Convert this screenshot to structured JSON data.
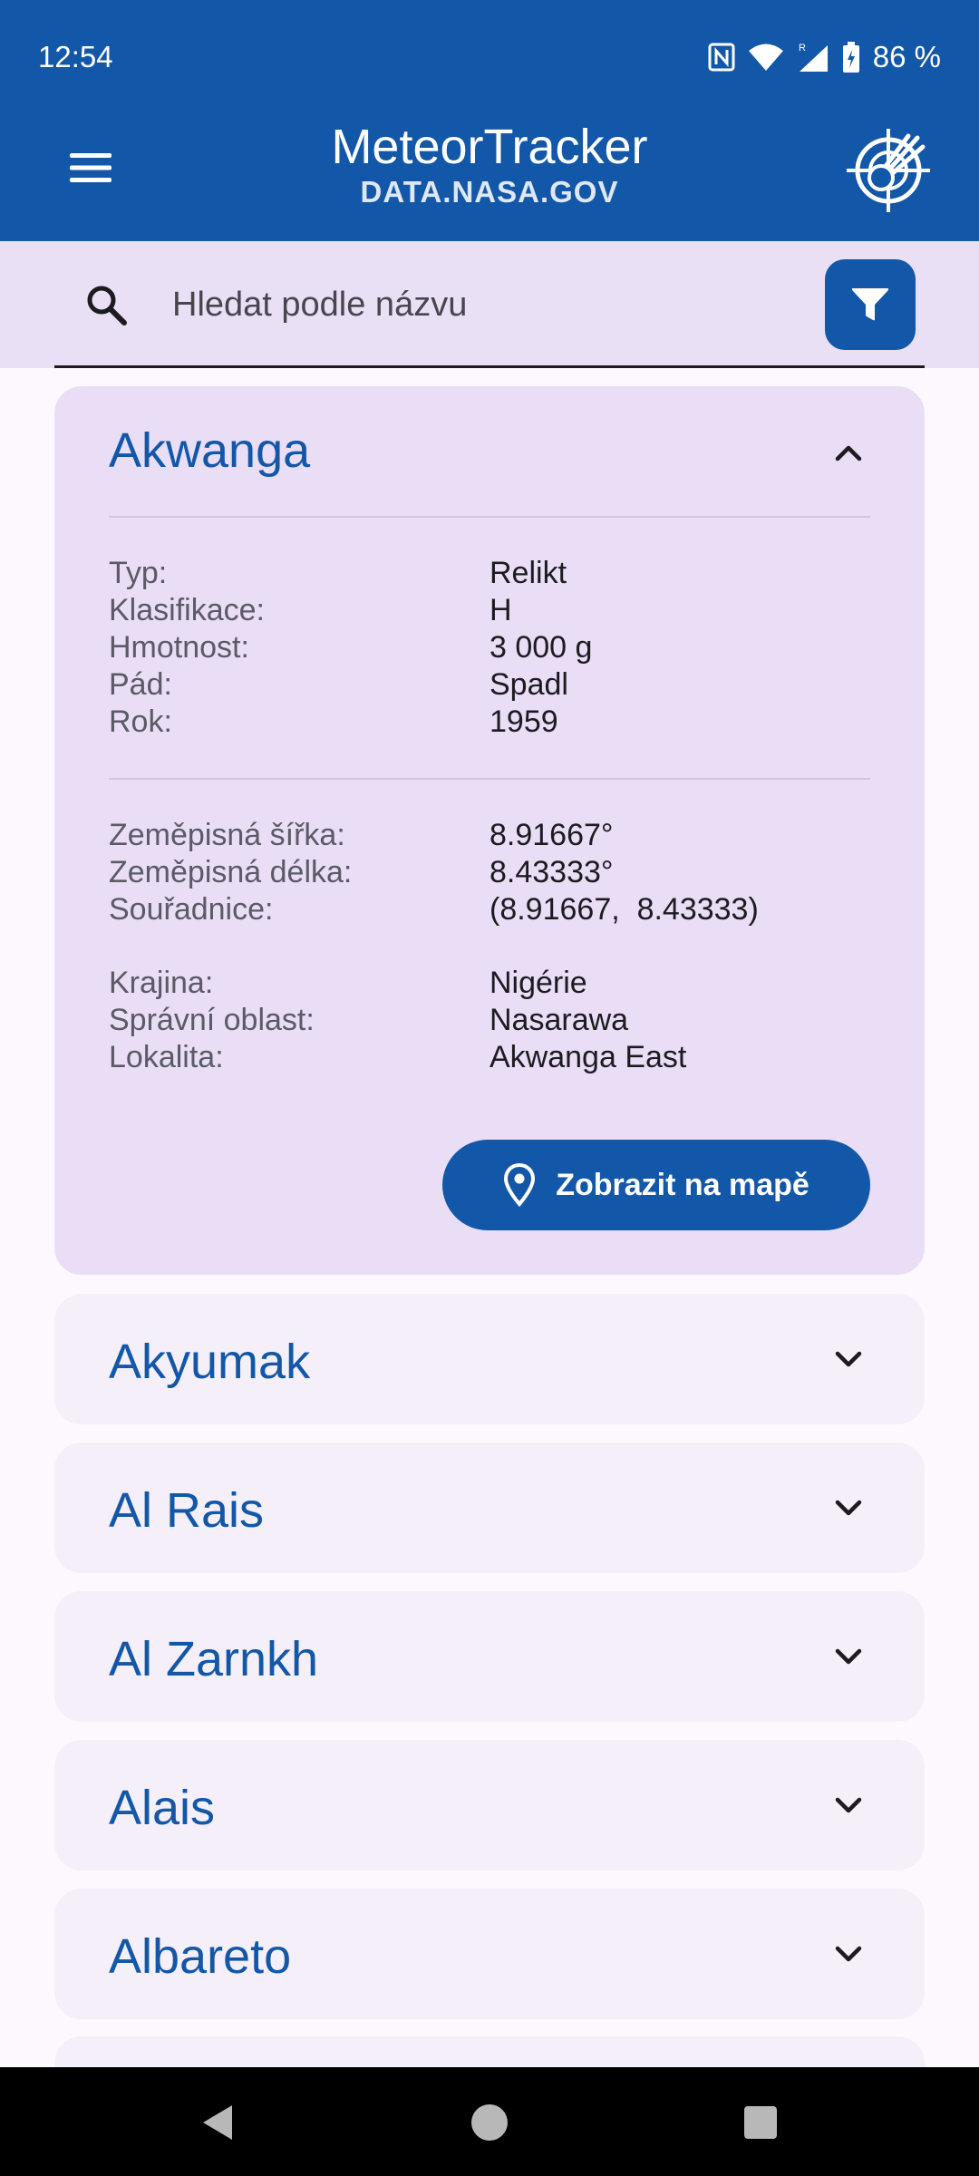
{
  "status_bar": {
    "time": "12:54",
    "battery": "86 %",
    "icons": [
      "nfc-icon",
      "wifi-icon",
      "signal-icon",
      "battery-icon"
    ]
  },
  "app_bar": {
    "title": "MeteorTracker",
    "subtitle": "DATA.NASA.GOV",
    "menu_icon": "menu-icon",
    "logo_icon": "meteor-radar-icon"
  },
  "search": {
    "placeholder": "Hledat podle názvu",
    "value": "",
    "filter_icon": "filter-icon"
  },
  "expanded": {
    "name": "Akwanga",
    "details": [
      {
        "label": "Typ:",
        "value": "Relikt"
      },
      {
        "label": "Klasifikace:",
        "value": "H"
      },
      {
        "label": "Hmotnost:",
        "value": "3 000 g"
      },
      {
        "label": "Pád:",
        "value": "Spadl"
      },
      {
        "label": "Rok:",
        "value": "1959"
      }
    ],
    "geo": [
      {
        "label": "Zeměpisná šířka:",
        "value": "8.91667°"
      },
      {
        "label": "Zeměpisná délka:",
        "value": "8.43333°"
      },
      {
        "label": "Souřadnice:",
        "value": "(8.91667,  8.43333)"
      }
    ],
    "location": [
      {
        "label": "Krajina:",
        "value": "Nigérie"
      },
      {
        "label": "Správní oblast:",
        "value": "Nasarawa"
      },
      {
        "label": "Lokalita:",
        "value": "Akwanga East"
      }
    ],
    "map_button_label": "Zobrazit na mapě"
  },
  "collapsed_items": [
    {
      "name": "Akyumak"
    },
    {
      "name": "Al Rais"
    },
    {
      "name": "Al Zarnkh"
    },
    {
      "name": "Alais"
    },
    {
      "name": "Albareto"
    }
  ],
  "colors": {
    "primary": "#1357a8",
    "expanded_card": "#e9def6",
    "collapsed_card": "#f5eff9",
    "search_bg": "#e9e0f6"
  }
}
